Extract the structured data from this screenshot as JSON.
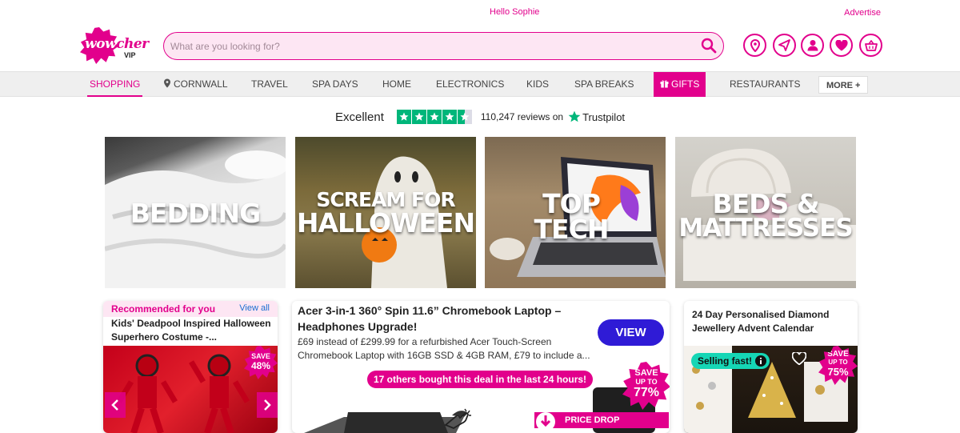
{
  "topbar": {
    "greeting": "Hello Sophie",
    "advertise": "Advertise"
  },
  "logo": {
    "text_a": "wow",
    "text_b": "cher",
    "sub": "VIP"
  },
  "search": {
    "placeholder": "What are you looking for?"
  },
  "header_icons": [
    "location-icon",
    "send-icon",
    "account-icon",
    "wishlist-heart-icon",
    "basket-icon"
  ],
  "nav": {
    "shopping": "SHOPPING",
    "cornwall": "CORNWALL",
    "travel": "TRAVEL",
    "spa_days": "SPA DAYS",
    "home": "HOME",
    "electronics": "ELECTRONICS",
    "kids": "KIDS",
    "spa_breaks": "SPA BREAKS",
    "gifts": "GIFTS",
    "restaurants": "RESTAURANTS",
    "more": "MORE +"
  },
  "trustpilot": {
    "rating_word": "Excellent",
    "reviews": "110,247 reviews on",
    "brand": "Trustpilot",
    "stars": 4.5
  },
  "tiles": {
    "bedding": "BEDDING",
    "halloween_line1": "SCREAM FOR",
    "halloween_line2": "HALLOWEEN",
    "tech_line1": "TOP",
    "tech_line2": "TECH",
    "beds_line1": "BEDS &",
    "beds_line2": "MATTRESSES"
  },
  "recommended": {
    "heading": "Recommended for you",
    "view_all": "View all",
    "title": "Kids' Deadpool Inspired Halloween Superhero Costume -...",
    "save_label": "SAVE",
    "save_value": "48%"
  },
  "laptop_deal": {
    "title": "Acer 3-in-1 360° Spin 11.6” Chromebook Laptop – Headphones Upgrade!",
    "description": "£69 instead of £299.99 for a refurbished Acer Touch-Screen Chromebook Laptop with 16GB SSD & 4GB RAM, £79 to include a...",
    "view_label": "VIEW",
    "others_bought": "17 others bought this deal in the last 24 hours!",
    "save_label": "SAVE",
    "save_upto": "UP TO",
    "save_value": "77%",
    "price_drop": "PRICE DROP"
  },
  "advent_deal": {
    "title": "24 Day Personalised Diamond Jewellery Advent Calendar",
    "selling_fast": "Selling fast!",
    "save_label": "SAVE",
    "save_upto": "UP TO",
    "save_value": "75%"
  },
  "colors": {
    "brand_pink": "#e2008c",
    "view_blue": "#2f1bd6",
    "trustpilot_green": "#00b67a",
    "selling_teal": "#15d6b5"
  }
}
